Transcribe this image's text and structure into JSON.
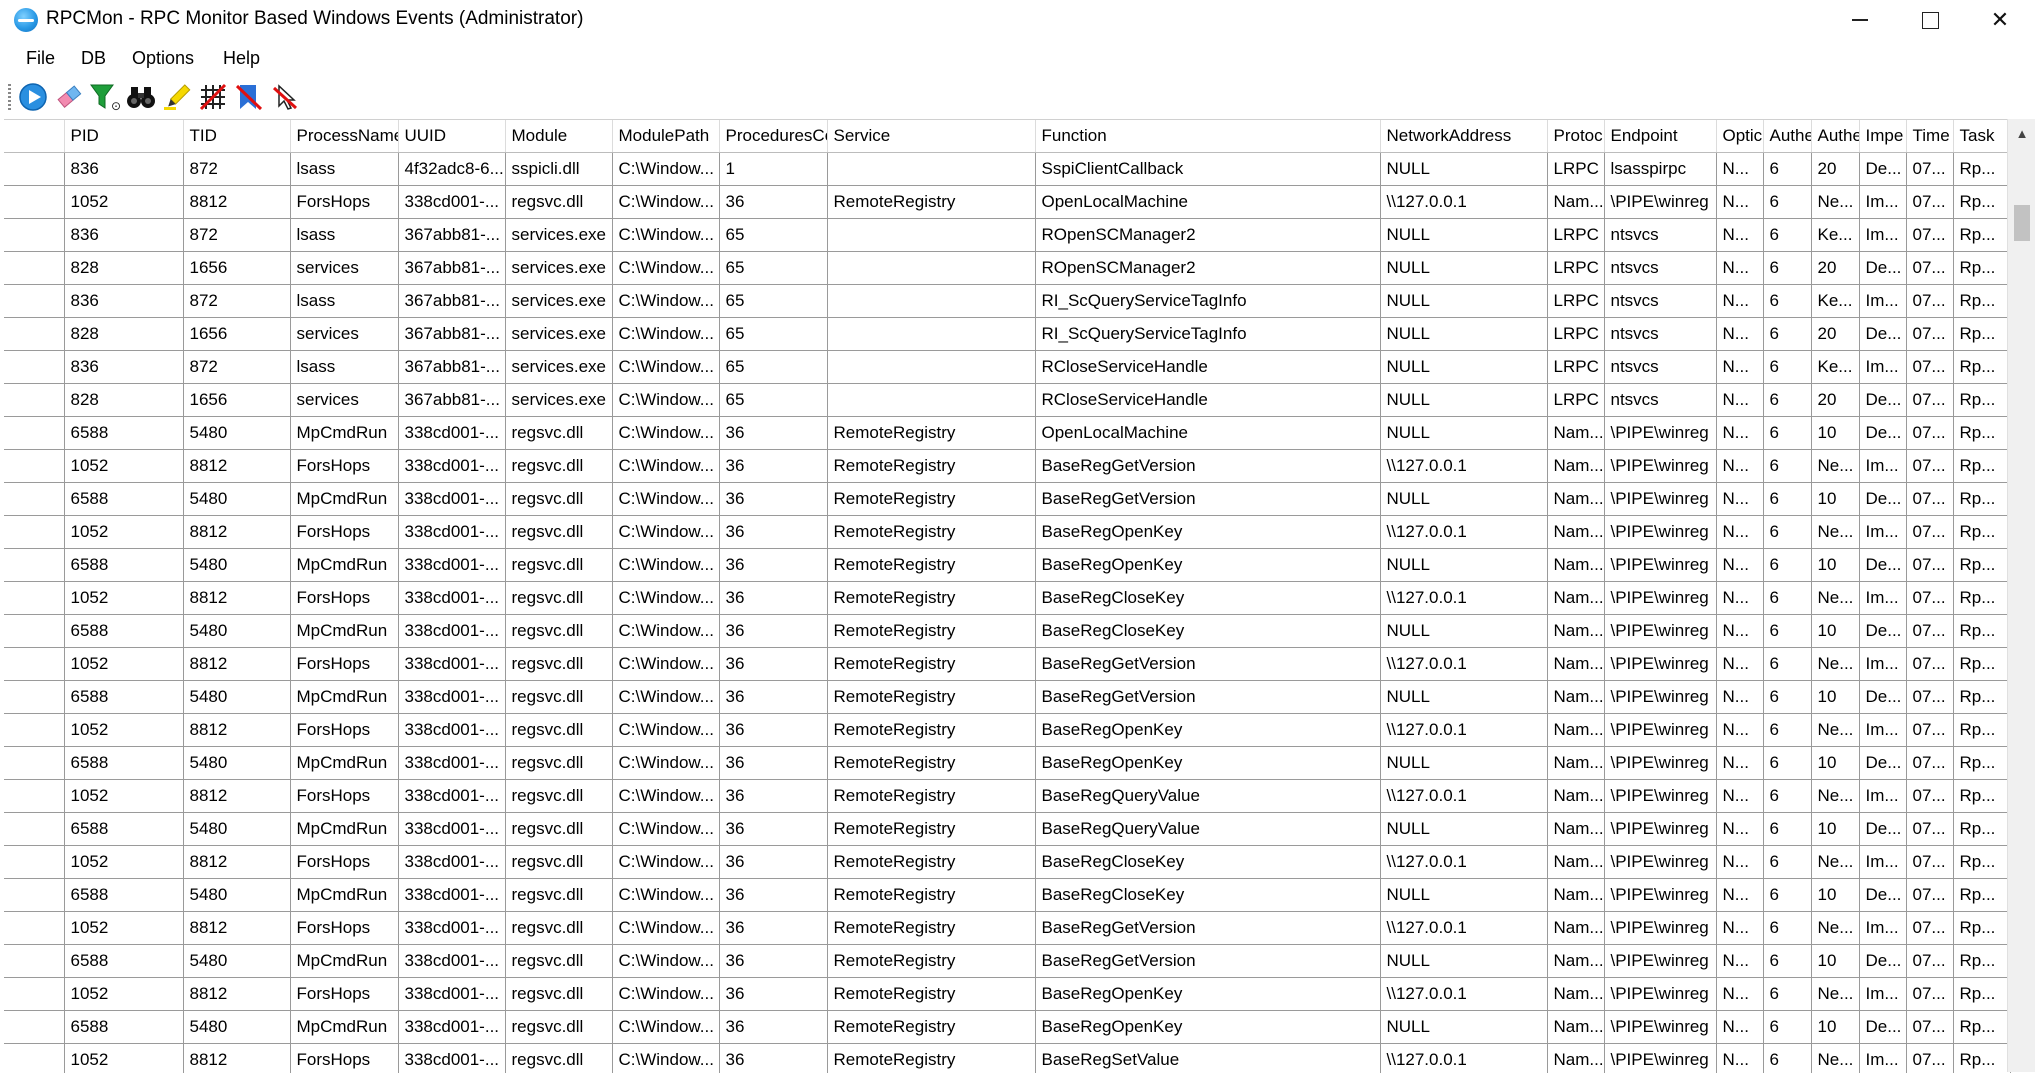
{
  "window": {
    "title": "RPCMon - RPC Monitor Based Windows Events (Administrator)",
    "controls": {
      "minimize": "minimize",
      "maximize": "maximize",
      "close": "✕"
    }
  },
  "menu": [
    "File",
    "DB",
    "Options",
    "Help"
  ],
  "toolbar": [
    {
      "icon": "play-icon"
    },
    {
      "icon": "eraser-icon"
    },
    {
      "icon": "filter-icon"
    },
    {
      "icon": "binoculars-icon"
    },
    {
      "icon": "highlight-icon"
    },
    {
      "icon": "grid-clear-icon"
    },
    {
      "icon": "bookmark-clear-icon"
    },
    {
      "icon": "cursor-cancel-icon"
    }
  ],
  "table": {
    "columns": [
      "",
      "PID",
      "TID",
      "ProcessName",
      "UUID",
      "Module",
      "ModulePath",
      "ProceduresCo",
      "Service",
      "Function",
      "NetworkAddress",
      "Protoc",
      "Endpoint",
      "Optic",
      "Authe",
      "Authe",
      "Impe",
      "Time",
      "Task"
    ],
    "rows": [
      [
        "836",
        "872",
        "lsass",
        "4f32adc8-6...",
        "sspicli.dll",
        "C:\\Window...",
        "1",
        "",
        "SspiClientCallback",
        "NULL",
        "LRPC",
        "lsasspirpc",
        "N...",
        "6",
        "20",
        "De...",
        "07...",
        "Rp..."
      ],
      [
        "1052",
        "8812",
        "ForsHops",
        "338cd001-...",
        "regsvc.dll",
        "C:\\Window...",
        "36",
        "RemoteRegistry",
        "OpenLocalMachine",
        "\\\\127.0.0.1",
        "Nam...",
        "\\PIPE\\winreg",
        "N...",
        "6",
        "Ne...",
        "Im...",
        "07...",
        "Rp..."
      ],
      [
        "836",
        "872",
        "lsass",
        "367abb81-...",
        "services.exe",
        "C:\\Window...",
        "65",
        "",
        "ROpenSCManager2",
        "NULL",
        "LRPC",
        "ntsvcs",
        "N...",
        "6",
        "Ke...",
        "Im...",
        "07...",
        "Rp..."
      ],
      [
        "828",
        "1656",
        "services",
        "367abb81-...",
        "services.exe",
        "C:\\Window...",
        "65",
        "",
        "ROpenSCManager2",
        "NULL",
        "LRPC",
        "ntsvcs",
        "N...",
        "6",
        "20",
        "De...",
        "07...",
        "Rp..."
      ],
      [
        "836",
        "872",
        "lsass",
        "367abb81-...",
        "services.exe",
        "C:\\Window...",
        "65",
        "",
        "RI_ScQueryServiceTagInfo",
        "NULL",
        "LRPC",
        "ntsvcs",
        "N...",
        "6",
        "Ke...",
        "Im...",
        "07...",
        "Rp..."
      ],
      [
        "828",
        "1656",
        "services",
        "367abb81-...",
        "services.exe",
        "C:\\Window...",
        "65",
        "",
        "RI_ScQueryServiceTagInfo",
        "NULL",
        "LRPC",
        "ntsvcs",
        "N...",
        "6",
        "20",
        "De...",
        "07...",
        "Rp..."
      ],
      [
        "836",
        "872",
        "lsass",
        "367abb81-...",
        "services.exe",
        "C:\\Window...",
        "65",
        "",
        "RCloseServiceHandle",
        "NULL",
        "LRPC",
        "ntsvcs",
        "N...",
        "6",
        "Ke...",
        "Im...",
        "07...",
        "Rp..."
      ],
      [
        "828",
        "1656",
        "services",
        "367abb81-...",
        "services.exe",
        "C:\\Window...",
        "65",
        "",
        "RCloseServiceHandle",
        "NULL",
        "LRPC",
        "ntsvcs",
        "N...",
        "6",
        "20",
        "De...",
        "07...",
        "Rp..."
      ],
      [
        "6588",
        "5480",
        "MpCmdRun",
        "338cd001-...",
        "regsvc.dll",
        "C:\\Window...",
        "36",
        "RemoteRegistry",
        "OpenLocalMachine",
        "NULL",
        "Nam...",
        "\\PIPE\\winreg",
        "N...",
        "6",
        "10",
        "De...",
        "07...",
        "Rp..."
      ],
      [
        "1052",
        "8812",
        "ForsHops",
        "338cd001-...",
        "regsvc.dll",
        "C:\\Window...",
        "36",
        "RemoteRegistry",
        "BaseRegGetVersion",
        "\\\\127.0.0.1",
        "Nam...",
        "\\PIPE\\winreg",
        "N...",
        "6",
        "Ne...",
        "Im...",
        "07...",
        "Rp..."
      ],
      [
        "6588",
        "5480",
        "MpCmdRun",
        "338cd001-...",
        "regsvc.dll",
        "C:\\Window...",
        "36",
        "RemoteRegistry",
        "BaseRegGetVersion",
        "NULL",
        "Nam...",
        "\\PIPE\\winreg",
        "N...",
        "6",
        "10",
        "De...",
        "07...",
        "Rp..."
      ],
      [
        "1052",
        "8812",
        "ForsHops",
        "338cd001-...",
        "regsvc.dll",
        "C:\\Window...",
        "36",
        "RemoteRegistry",
        "BaseRegOpenKey",
        "\\\\127.0.0.1",
        "Nam...",
        "\\PIPE\\winreg",
        "N...",
        "6",
        "Ne...",
        "Im...",
        "07...",
        "Rp..."
      ],
      [
        "6588",
        "5480",
        "MpCmdRun",
        "338cd001-...",
        "regsvc.dll",
        "C:\\Window...",
        "36",
        "RemoteRegistry",
        "BaseRegOpenKey",
        "NULL",
        "Nam...",
        "\\PIPE\\winreg",
        "N...",
        "6",
        "10",
        "De...",
        "07...",
        "Rp..."
      ],
      [
        "1052",
        "8812",
        "ForsHops",
        "338cd001-...",
        "regsvc.dll",
        "C:\\Window...",
        "36",
        "RemoteRegistry",
        "BaseRegCloseKey",
        "\\\\127.0.0.1",
        "Nam...",
        "\\PIPE\\winreg",
        "N...",
        "6",
        "Ne...",
        "Im...",
        "07...",
        "Rp..."
      ],
      [
        "6588",
        "5480",
        "MpCmdRun",
        "338cd001-...",
        "regsvc.dll",
        "C:\\Window...",
        "36",
        "RemoteRegistry",
        "BaseRegCloseKey",
        "NULL",
        "Nam...",
        "\\PIPE\\winreg",
        "N...",
        "6",
        "10",
        "De...",
        "07...",
        "Rp..."
      ],
      [
        "1052",
        "8812",
        "ForsHops",
        "338cd001-...",
        "regsvc.dll",
        "C:\\Window...",
        "36",
        "RemoteRegistry",
        "BaseRegGetVersion",
        "\\\\127.0.0.1",
        "Nam...",
        "\\PIPE\\winreg",
        "N...",
        "6",
        "Ne...",
        "Im...",
        "07...",
        "Rp..."
      ],
      [
        "6588",
        "5480",
        "MpCmdRun",
        "338cd001-...",
        "regsvc.dll",
        "C:\\Window...",
        "36",
        "RemoteRegistry",
        "BaseRegGetVersion",
        "NULL",
        "Nam...",
        "\\PIPE\\winreg",
        "N...",
        "6",
        "10",
        "De...",
        "07...",
        "Rp..."
      ],
      [
        "1052",
        "8812",
        "ForsHops",
        "338cd001-...",
        "regsvc.dll",
        "C:\\Window...",
        "36",
        "RemoteRegistry",
        "BaseRegOpenKey",
        "\\\\127.0.0.1",
        "Nam...",
        "\\PIPE\\winreg",
        "N...",
        "6",
        "Ne...",
        "Im...",
        "07...",
        "Rp..."
      ],
      [
        "6588",
        "5480",
        "MpCmdRun",
        "338cd001-...",
        "regsvc.dll",
        "C:\\Window...",
        "36",
        "RemoteRegistry",
        "BaseRegOpenKey",
        "NULL",
        "Nam...",
        "\\PIPE\\winreg",
        "N...",
        "6",
        "10",
        "De...",
        "07...",
        "Rp..."
      ],
      [
        "1052",
        "8812",
        "ForsHops",
        "338cd001-...",
        "regsvc.dll",
        "C:\\Window...",
        "36",
        "RemoteRegistry",
        "BaseRegQueryValue",
        "\\\\127.0.0.1",
        "Nam...",
        "\\PIPE\\winreg",
        "N...",
        "6",
        "Ne...",
        "Im...",
        "07...",
        "Rp..."
      ],
      [
        "6588",
        "5480",
        "MpCmdRun",
        "338cd001-...",
        "regsvc.dll",
        "C:\\Window...",
        "36",
        "RemoteRegistry",
        "BaseRegQueryValue",
        "NULL",
        "Nam...",
        "\\PIPE\\winreg",
        "N...",
        "6",
        "10",
        "De...",
        "07...",
        "Rp..."
      ],
      [
        "1052",
        "8812",
        "ForsHops",
        "338cd001-...",
        "regsvc.dll",
        "C:\\Window...",
        "36",
        "RemoteRegistry",
        "BaseRegCloseKey",
        "\\\\127.0.0.1",
        "Nam...",
        "\\PIPE\\winreg",
        "N...",
        "6",
        "Ne...",
        "Im...",
        "07...",
        "Rp..."
      ],
      [
        "6588",
        "5480",
        "MpCmdRun",
        "338cd001-...",
        "regsvc.dll",
        "C:\\Window...",
        "36",
        "RemoteRegistry",
        "BaseRegCloseKey",
        "NULL",
        "Nam...",
        "\\PIPE\\winreg",
        "N...",
        "6",
        "10",
        "De...",
        "07...",
        "Rp..."
      ],
      [
        "1052",
        "8812",
        "ForsHops",
        "338cd001-...",
        "regsvc.dll",
        "C:\\Window...",
        "36",
        "RemoteRegistry",
        "BaseRegGetVersion",
        "\\\\127.0.0.1",
        "Nam...",
        "\\PIPE\\winreg",
        "N...",
        "6",
        "Ne...",
        "Im...",
        "07...",
        "Rp..."
      ],
      [
        "6588",
        "5480",
        "MpCmdRun",
        "338cd001-...",
        "regsvc.dll",
        "C:\\Window...",
        "36",
        "RemoteRegistry",
        "BaseRegGetVersion",
        "NULL",
        "Nam...",
        "\\PIPE\\winreg",
        "N...",
        "6",
        "10",
        "De...",
        "07...",
        "Rp..."
      ],
      [
        "1052",
        "8812",
        "ForsHops",
        "338cd001-...",
        "regsvc.dll",
        "C:\\Window...",
        "36",
        "RemoteRegistry",
        "BaseRegOpenKey",
        "\\\\127.0.0.1",
        "Nam...",
        "\\PIPE\\winreg",
        "N...",
        "6",
        "Ne...",
        "Im...",
        "07...",
        "Rp..."
      ],
      [
        "6588",
        "5480",
        "MpCmdRun",
        "338cd001-...",
        "regsvc.dll",
        "C:\\Window...",
        "36",
        "RemoteRegistry",
        "BaseRegOpenKey",
        "NULL",
        "Nam...",
        "\\PIPE\\winreg",
        "N...",
        "6",
        "10",
        "De...",
        "07...",
        "Rp..."
      ],
      [
        "1052",
        "8812",
        "ForsHops",
        "338cd001-...",
        "regsvc.dll",
        "C:\\Window...",
        "36",
        "RemoteRegistry",
        "BaseRegSetValue",
        "\\\\127.0.0.1",
        "Nam...",
        "\\PIPE\\winreg",
        "N...",
        "6",
        "Ne...",
        "Im...",
        "07...",
        "Rp..."
      ]
    ]
  },
  "scrollbar": {
    "up_arrow": "▲"
  }
}
